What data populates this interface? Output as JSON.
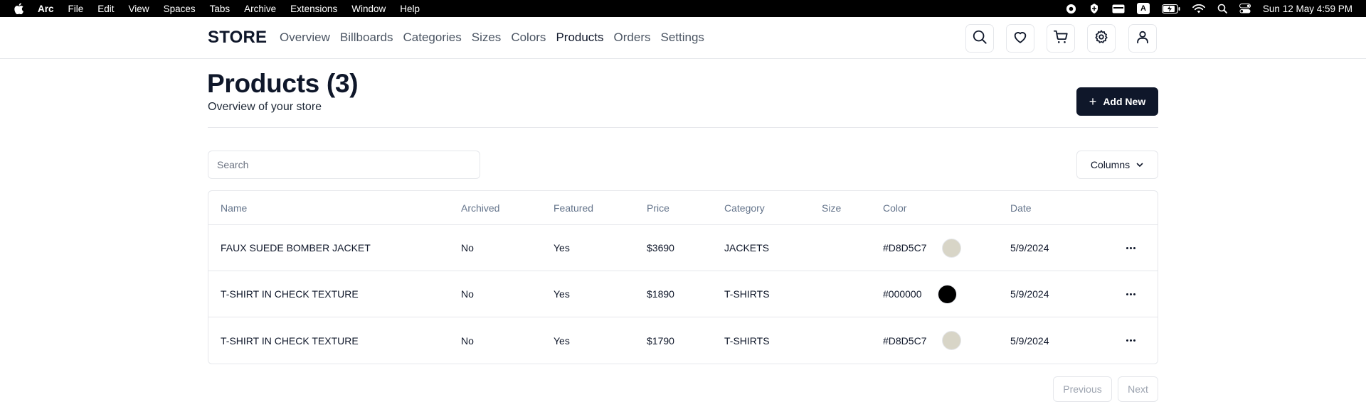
{
  "menubar": {
    "app": "Arc",
    "items": [
      "File",
      "Edit",
      "View",
      "Spaces",
      "Tabs",
      "Archive",
      "Extensions",
      "Window",
      "Help"
    ],
    "clock": "Sun 12 May  4:59 PM",
    "icons": [
      "apple-logo",
      "record-icon",
      "vpn-icon",
      "card-icon",
      "input-source-icon",
      "battery-icon",
      "wifi-icon",
      "spotlight-icon",
      "control-center-icon"
    ],
    "input_source": "A"
  },
  "header": {
    "logo": "STORE",
    "nav": [
      "Overview",
      "Billboards",
      "Categories",
      "Sizes",
      "Colors",
      "Products",
      "Orders",
      "Settings"
    ],
    "active_nav": "Products",
    "icons": [
      "search-icon",
      "heart-icon",
      "cart-icon",
      "gear-icon",
      "user-icon"
    ]
  },
  "page": {
    "title": "Products (3)",
    "subtitle": "Overview of your store",
    "add_button": "Add New",
    "add_icon": "+"
  },
  "toolbar": {
    "search_placeholder": "Search",
    "search_value": "",
    "columns_button": "Columns"
  },
  "table": {
    "columns": [
      "Name",
      "Archived",
      "Featured",
      "Price",
      "Category",
      "Size",
      "Color",
      "Date"
    ],
    "rows": [
      {
        "name": "FAUX SUEDE BOMBER JACKET",
        "archived": "No",
        "featured": "Yes",
        "price": "$3690",
        "category": "JACKETS",
        "size": "",
        "color": "#D8D5C7",
        "date": "5/9/2024"
      },
      {
        "name": "T-SHIRT IN CHECK TEXTURE",
        "archived": "No",
        "featured": "Yes",
        "price": "$1890",
        "category": "T-SHIRTS",
        "size": "",
        "color": "#000000",
        "date": "5/9/2024"
      },
      {
        "name": "T-SHIRT IN CHECK TEXTURE",
        "archived": "No",
        "featured": "Yes",
        "price": "$1790",
        "category": "T-SHIRTS",
        "size": "",
        "color": "#D8D5C7",
        "date": "5/9/2024"
      }
    ]
  },
  "pagination": {
    "previous": "Previous",
    "next": "Next"
  },
  "colors": {
    "primary": "#0f172a",
    "border": "#e5e7eb",
    "muted_text": "#64748b"
  }
}
